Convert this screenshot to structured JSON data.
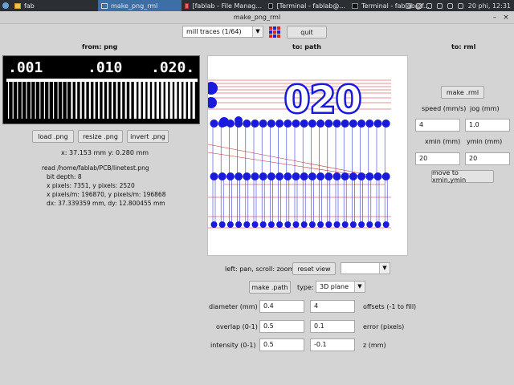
{
  "taskbar": {
    "items": [
      {
        "label": "fab",
        "icon": "folder-icon",
        "active": false
      },
      {
        "label": "make_png_rml",
        "icon": "window-icon",
        "active": true
      },
      {
        "label": "[fablab - File Manag...",
        "icon": "home-icon",
        "active": false
      },
      {
        "label": "[Terminal - fablab@...",
        "icon": "terminal-icon",
        "active": false
      },
      {
        "label": "Terminal - fablab@f...",
        "icon": "terminal-icon",
        "active": false
      }
    ],
    "clock": "20 phi, 12:31"
  },
  "window": {
    "title": "make_png_rml",
    "minimize": "–",
    "close": "×"
  },
  "toolbar": {
    "process_value": "mill traces (1/64)",
    "quit_label": "quit"
  },
  "from_panel": {
    "header": "from: png",
    "preview_numbers": [
      ".001",
      ".010",
      ".020."
    ],
    "load_label": "load .png",
    "resize_label": "resize .png",
    "invert_label": "invert .png",
    "size_text": "x: 37.153 mm  y: 0.280 mm",
    "info": {
      "read": "read /home/fablab/PCB/linetest.png",
      "bit_depth": "bit depth: 8",
      "pixels": "x pixels: 7351, y pixels: 2520",
      "pixels_per_m": "x pixels/m: 196870, y pixels/m: 196868",
      "dxdy": "dx: 37.339359 mm, dy: 12.800455 mm"
    }
  },
  "path_panel": {
    "header": "to: path",
    "pan_hint": "left: pan, scroll: zoom",
    "reset_view_label": "reset view",
    "view_select_value": "",
    "make_path_label": "make .path",
    "type_label": "type:",
    "type_value": "3D plane",
    "params": {
      "diameter_label": "diameter (mm)",
      "diameter_value": "0.4",
      "offsets_value": "4",
      "offsets_label": "offsets (-1 to fill)",
      "overlap_label": "overlap (0-1)",
      "overlap_value": "0.5",
      "error_value": "0.1",
      "error_label": "error (pixels)",
      "intensity_label": "intensity (0-1)",
      "intensity_value": "0.5",
      "z_value": "-0.1",
      "z_label": "z (mm)"
    }
  },
  "rml_panel": {
    "header": "to: rml",
    "make_rml_label": "make .rml",
    "speed_label": "speed (mm/s)",
    "speed_value": "4",
    "jog_label": "jog (mm)",
    "jog_value": "1.0",
    "xmin_label": "xmin (mm)",
    "xmin_value": "20",
    "ymin_label": "ymin (mm)",
    "ymin_value": "20",
    "move_label": "move to xmin,ymin"
  },
  "colors": {
    "path_blue": "#1a1adc",
    "path_red": "#cc2222",
    "taskbar": "#2b2f33",
    "active_tab": "#3d6fa6"
  }
}
